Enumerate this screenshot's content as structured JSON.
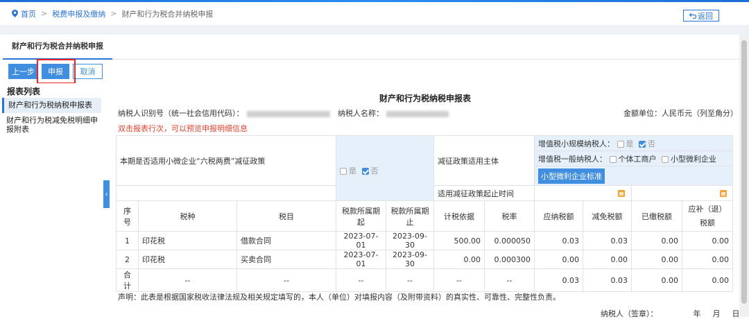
{
  "breadcrumb": {
    "home": "首页",
    "level2": "税费申报及缴纳",
    "current": "财产和行为税合并纳税申报",
    "sep": ">"
  },
  "back_button": "返回",
  "title_tab": "财产和行为税合并纳税申报",
  "toolbar": {
    "prev": "上一步",
    "submit": "申报",
    "cancel": "取消"
  },
  "sidebar": {
    "title": "报表列表",
    "items": [
      "财产和行为税纳税申报表",
      "财产和行为税减免税明细申报附表"
    ]
  },
  "form": {
    "title": "财产和行为税纳税申报表",
    "taxpayer_id_label": "纳税人识别号（统一社会信用代码）：",
    "taxpayer_name_label": "纳税人名称：",
    "unit_label": "金额单位：人民币元（列至角分）",
    "hint": "双击报表行次，可以预览申报明细信息",
    "policy_question": "本期是否适用小微企业“六税两费”减征政策",
    "yes": "是",
    "no": "否",
    "subject_label": "减征政策适用主体",
    "small_scale_label": "增值税小规模纳税人：",
    "general_label": "增值税一般纳税人：",
    "individual_label": "个体工商户",
    "small_micro_label": "小型微利企业",
    "standard_button": "小型微利企业标准",
    "period_label": "适用减征政策起止时间",
    "declaration": "声明：此表是根据国家税收法律法规及相关规定填写的，本人（单位）对填报内容（及附带资料）的真实性、可靠性、完整性负责。",
    "sign": {
      "label": "纳税人（签章）：",
      "year": "年",
      "month": "月",
      "day": "日"
    }
  },
  "table": {
    "headers": [
      "序号",
      "税种",
      "税目",
      "税款所属期起",
      "税款所属期止",
      "计税依据",
      "税率",
      "应纳税额",
      "减免税额",
      "已缴税额",
      "应补（退）税额"
    ],
    "rows": [
      [
        "1",
        "印花税",
        "借款合同",
        "2023-07-01",
        "2023-09-30",
        "500.00",
        "0.000050",
        "0.03",
        "0.03",
        "0.00",
        "0.00"
      ],
      [
        "2",
        "印花税",
        "买卖合同",
        "2023-07-01",
        "2023-09-30",
        "0.00",
        "0.000300",
        "0.00",
        "0.00",
        "0.00",
        "0.00"
      ]
    ],
    "total": [
      "合计",
      "--",
      "--",
      "--",
      "--",
      "--",
      "--",
      "0.03",
      "0.03",
      "0.00",
      "0.00"
    ]
  },
  "colors": {
    "accent": "#3f8ee0",
    "hint_red": "#e5422e",
    "highlight_box": "#e22222"
  }
}
